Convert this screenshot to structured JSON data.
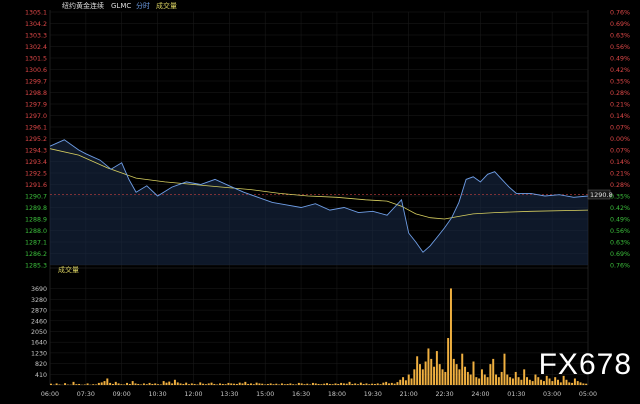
{
  "header": {
    "title": "纽约黄金连续",
    "symbol": "GLMC",
    "mode": "分时",
    "volume_label": "成交量"
  },
  "price_badge": "1290.8",
  "watermark": "FX678",
  "colors": {
    "background": "#000000",
    "price_line": "#6f9ee6",
    "price_fill": "#1a2c4a",
    "avg_line": "#d8d060",
    "volume_bar": "#f0b040",
    "ref_line": "#c04040",
    "up_text": "#e04848",
    "down_text": "#3cc03c",
    "neutral_text": "#cccccc",
    "axis_text": "#c8c8c8",
    "grid": "#1c1c1c"
  },
  "chart_data": [
    {
      "type": "line",
      "title": "纽约黄金连续 GLMC 分时",
      "reference_price": 1290.8,
      "price_ticks": [
        1305.1,
        1304.2,
        1303.3,
        1302.4,
        1301.5,
        1300.6,
        1299.7,
        1298.8,
        1297.9,
        1297.0,
        1296.1,
        1295.2,
        1294.3,
        1293.4,
        1292.5,
        1291.6,
        1290.7,
        1289.8,
        1288.9,
        1288.0,
        1287.1,
        1286.2,
        1285.3
      ],
      "percent_ticks": [
        "0.76%",
        "0.69%",
        "0.63%",
        "0.56%",
        "0.49%",
        "0.42%",
        "0.35%",
        "0.28%",
        "0.21%",
        "0.14%",
        "0.07%",
        "0.00%",
        "0.07%",
        "0.14%",
        "0.21%",
        "0.28%",
        "0.35%",
        "0.42%",
        "0.49%",
        "0.56%",
        "0.63%",
        "0.69%",
        "0.76%"
      ],
      "ylim": [
        1285.3,
        1305.1
      ],
      "x_ticks": [
        "06:00",
        "07:30",
        "09:00",
        "10:30",
        "12:00",
        "13:30",
        "15:00",
        "16:30",
        "18:00",
        "19:30",
        "21:00",
        "22:30",
        "24:00",
        "01:30",
        "03:00",
        "05:00"
      ],
      "series": [
        {
          "name": "price",
          "points": [
            [
              0,
              1294.6
            ],
            [
              4,
              1295.1
            ],
            [
              8,
              1294.3
            ],
            [
              10,
              1294.0
            ],
            [
              14,
              1293.5
            ],
            [
              17,
              1292.8
            ],
            [
              20,
              1293.3
            ],
            [
              22,
              1292.0
            ],
            [
              24,
              1291.0
            ],
            [
              27,
              1291.5
            ],
            [
              30,
              1290.7
            ],
            [
              34,
              1291.4
            ],
            [
              38,
              1291.8
            ],
            [
              42,
              1291.6
            ],
            [
              46,
              1292.0
            ],
            [
              50,
              1291.5
            ],
            [
              54,
              1291.0
            ],
            [
              58,
              1290.6
            ],
            [
              62,
              1290.2
            ],
            [
              66,
              1290.0
            ],
            [
              70,
              1289.8
            ],
            [
              74,
              1290.1
            ],
            [
              78,
              1289.6
            ],
            [
              82,
              1289.8
            ],
            [
              86,
              1289.4
            ],
            [
              90,
              1289.5
            ],
            [
              94,
              1289.2
            ],
            [
              96,
              1289.8
            ],
            [
              98,
              1290.4
            ],
            [
              100,
              1287.8
            ],
            [
              102,
              1287.1
            ],
            [
              104,
              1286.3
            ],
            [
              106,
              1286.8
            ],
            [
              108,
              1287.5
            ],
            [
              110,
              1288.2
            ],
            [
              112,
              1289.0
            ],
            [
              114,
              1290.2
            ],
            [
              116,
              1292.0
            ],
            [
              118,
              1292.2
            ],
            [
              120,
              1291.8
            ],
            [
              122,
              1292.4
            ],
            [
              124,
              1292.6
            ],
            [
              126,
              1292.0
            ],
            [
              128,
              1291.4
            ],
            [
              130,
              1290.9
            ],
            [
              134,
              1290.9
            ],
            [
              138,
              1290.7
            ],
            [
              142,
              1290.8
            ],
            [
              146,
              1290.6
            ],
            [
              150,
              1290.7
            ]
          ]
        },
        {
          "name": "average",
          "points": [
            [
              0,
              1294.4
            ],
            [
              8,
              1293.9
            ],
            [
              16,
              1292.9
            ],
            [
              24,
              1292.1
            ],
            [
              32,
              1291.8
            ],
            [
              40,
              1291.6
            ],
            [
              48,
              1291.4
            ],
            [
              56,
              1291.2
            ],
            [
              64,
              1290.9
            ],
            [
              72,
              1290.7
            ],
            [
              80,
              1290.6
            ],
            [
              88,
              1290.4
            ],
            [
              94,
              1290.3
            ],
            [
              98,
              1289.9
            ],
            [
              102,
              1289.3
            ],
            [
              106,
              1289.0
            ],
            [
              110,
              1288.9
            ],
            [
              114,
              1289.1
            ],
            [
              118,
              1289.3
            ],
            [
              124,
              1289.4
            ],
            [
              134,
              1289.5
            ],
            [
              150,
              1289.6
            ]
          ]
        }
      ]
    },
    {
      "type": "bar",
      "title": "成交量",
      "ylim": [
        0,
        4100
      ],
      "y_ticks": [
        410,
        820,
        1230,
        1640,
        2050,
        2460,
        2870,
        3280,
        3690
      ],
      "values": [
        50,
        10,
        60,
        20,
        5,
        70,
        15,
        10,
        120,
        30,
        40,
        10,
        20,
        60,
        10,
        30,
        20,
        80,
        100,
        150,
        250,
        80,
        40,
        120,
        60,
        30,
        20,
        80,
        40,
        150,
        60,
        40,
        20,
        60,
        30,
        80,
        40,
        60,
        30,
        20,
        150,
        90,
        130,
        60,
        200,
        100,
        60,
        40,
        90,
        30,
        60,
        40,
        20,
        100,
        50,
        30,
        60,
        90,
        40,
        20,
        60,
        40,
        30,
        80,
        60,
        50,
        40,
        90,
        60,
        120,
        40,
        60,
        30,
        90,
        60,
        50,
        20,
        40,
        60,
        30,
        50,
        20,
        60,
        30,
        40,
        60,
        30,
        20,
        80,
        60,
        30,
        50,
        20,
        80,
        60,
        40,
        30,
        50,
        70,
        40,
        30,
        60,
        40,
        80,
        60,
        50,
        120,
        40,
        60,
        30,
        90,
        40,
        60,
        30,
        50,
        40,
        60,
        30,
        90,
        120,
        60,
        80,
        50,
        110,
        200,
        300,
        180,
        400,
        250,
        600,
        1100,
        800,
        600,
        900,
        1400,
        1000,
        700,
        1300,
        800,
        600,
        500,
        1800,
        3700,
        1000,
        800,
        600,
        1200,
        700,
        500,
        400,
        900,
        300,
        250,
        600,
        400,
        300,
        800,
        1000,
        400,
        300,
        500,
        1200,
        400,
        300,
        250,
        500,
        300,
        200,
        600,
        300,
        200,
        150,
        400,
        300,
        200,
        150,
        350,
        250,
        150,
        300,
        200,
        100,
        350,
        200,
        100,
        80,
        250,
        150,
        100,
        60,
        50
      ]
    }
  ]
}
